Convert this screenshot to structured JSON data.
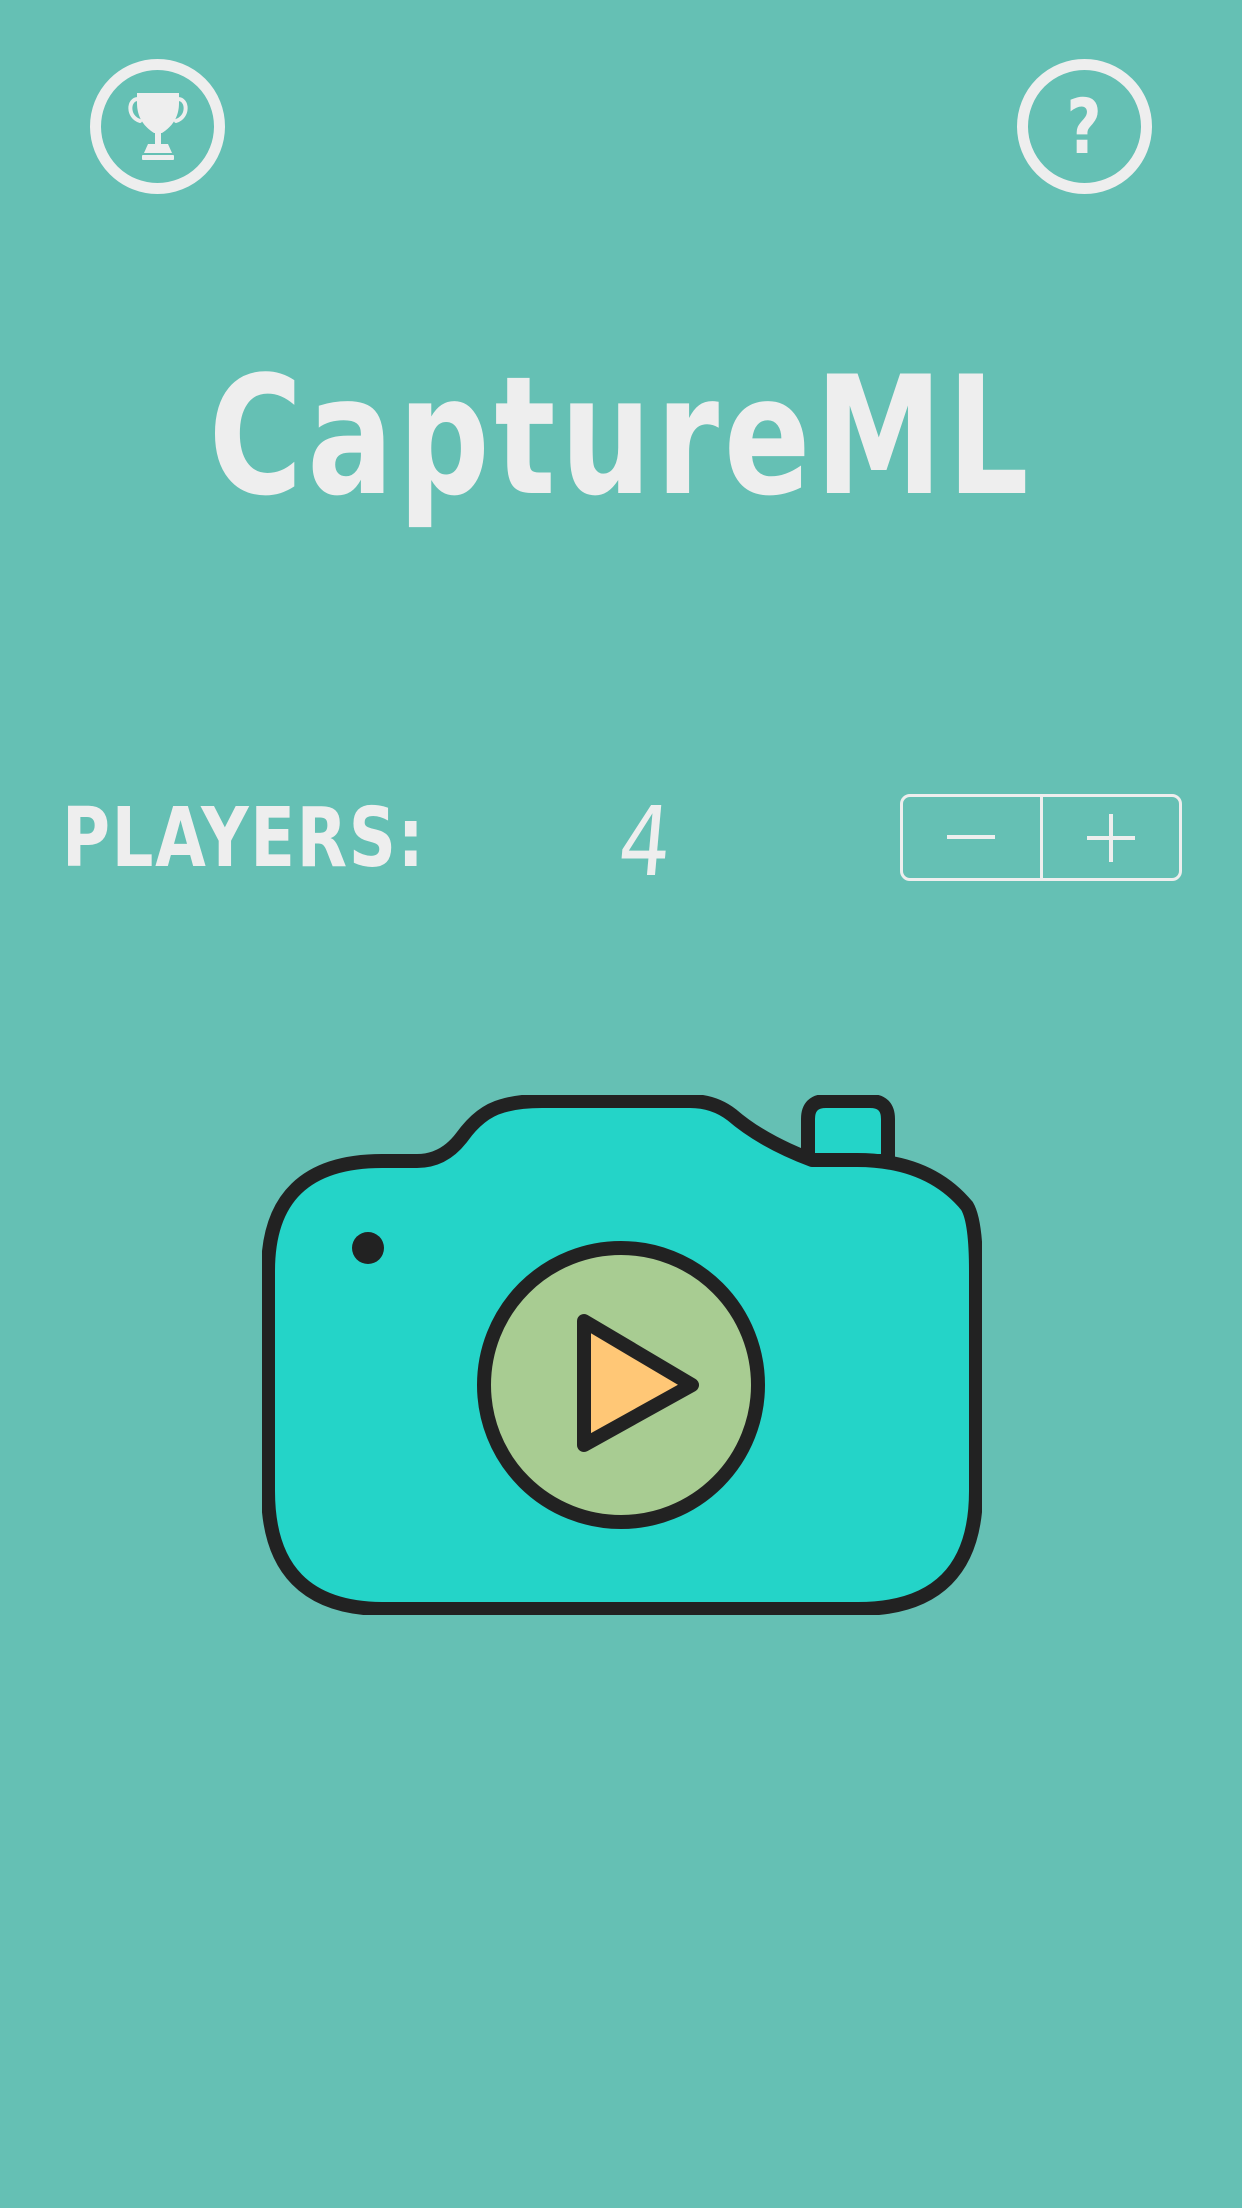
{
  "app": {
    "title": "CaptureML"
  },
  "toolbar": {
    "leaderboard_icon": "trophy-icon",
    "help_icon": "question-mark-icon",
    "help_glyph": "?"
  },
  "players": {
    "label": "PLAYERS:",
    "count": "4",
    "decrement_icon": "minus-icon",
    "increment_icon": "plus-icon"
  },
  "start": {
    "icon": "camera-play-icon"
  },
  "colors": {
    "background": "#65c0b4",
    "foreground": "#eeeeee",
    "camera_body": "#24d4c8",
    "outline": "#222222",
    "lens": "#a8cc92",
    "play": "#ffc776"
  }
}
